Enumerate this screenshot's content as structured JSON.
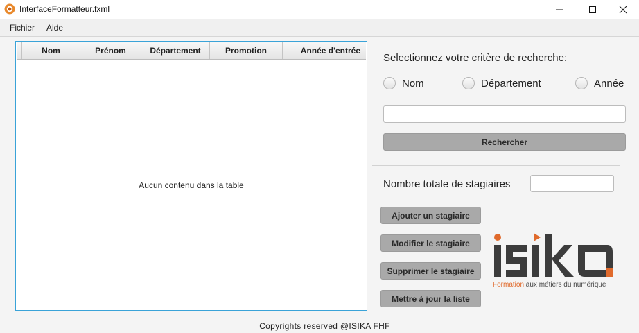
{
  "window": {
    "title": "InterfaceFormatteur.fxml"
  },
  "menu": {
    "items": [
      "Fichier",
      "Aide"
    ]
  },
  "table": {
    "columns": [
      "Nom",
      "Prénom",
      "Département",
      "Promotion",
      "Année d'entrée"
    ],
    "rows": [],
    "placeholder": "Aucun contenu dans la table"
  },
  "search": {
    "title": "Selectionnez votre critère de recherche:",
    "options": [
      "Nom",
      "Département",
      "Année"
    ],
    "selected": null,
    "input_value": "",
    "button_label": "Rechercher"
  },
  "stats": {
    "total_label": "Nombre totale de stagiaires",
    "total_value": ""
  },
  "actions": {
    "add": "Ajouter un stagiaire",
    "edit": "Modifier le stagiaire",
    "delete": "Supprimer le stagiaire",
    "refresh": "Mettre à jour la liste"
  },
  "logo": {
    "name": "isika",
    "tagline_accent": "Formation",
    "tagline_rest": " aux métiers du numérique",
    "colors": {
      "accent": "#e06a2c",
      "dark": "#3c3c3c"
    }
  },
  "footer": {
    "text": "Copyrights reserved @ISIKA FHF"
  },
  "colors": {
    "table_border": "#3aa3d8",
    "button_bg": "#a9a9a9",
    "window_bg": "#f4f4f4"
  }
}
